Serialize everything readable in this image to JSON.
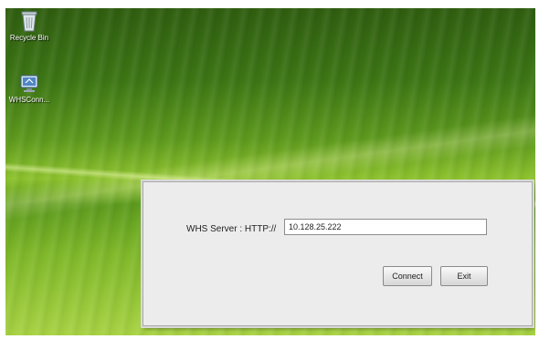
{
  "desktop": {
    "icons": [
      {
        "label": "Recycle Bin",
        "icon": "recycle-bin-icon"
      },
      {
        "label": "WHSConn...",
        "icon": "connector-icon"
      }
    ]
  },
  "dialog": {
    "server_label": "WHS Server : HTTP://",
    "server_value": "10.128.25.222",
    "connect_label": "Connect",
    "exit_label": "Exit"
  },
  "colors": {
    "dialog_bg": "#ececec",
    "wallpaper_green": "#5e9a1e"
  }
}
